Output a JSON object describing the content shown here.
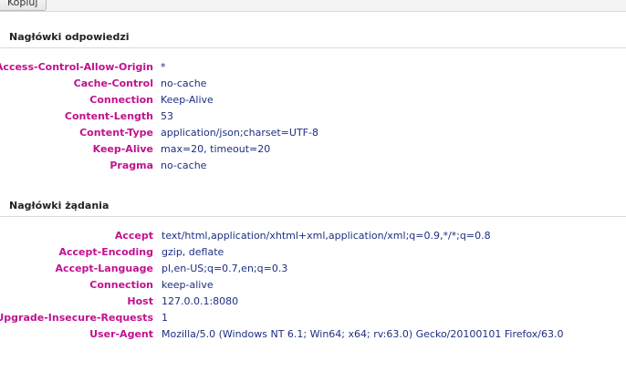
{
  "toolbar": {
    "copy_label": "Kopiuj"
  },
  "response_headers": {
    "title": "Nagłówki odpowiedzi",
    "rows": [
      {
        "name": "Access-Control-Allow-Origin",
        "value": "*"
      },
      {
        "name": "Cache-Control",
        "value": "no-cache"
      },
      {
        "name": "Connection",
        "value": "Keep-Alive"
      },
      {
        "name": "Content-Length",
        "value": "53"
      },
      {
        "name": "Content-Type",
        "value": "application/json;charset=UTF-8"
      },
      {
        "name": "Keep-Alive",
        "value": "max=20, timeout=20"
      },
      {
        "name": "Pragma",
        "value": "no-cache"
      }
    ]
  },
  "request_headers": {
    "title": "Nagłówki żądania",
    "rows": [
      {
        "name": "Accept",
        "value": "text/html,application/xhtml+xml,application/xml;q=0.9,*/*;q=0.8"
      },
      {
        "name": "Accept-Encoding",
        "value": "gzip, deflate"
      },
      {
        "name": "Accept-Language",
        "value": "pl,en-US;q=0.7,en;q=0.3"
      },
      {
        "name": "Connection",
        "value": "keep-alive"
      },
      {
        "name": "Host",
        "value": "127.0.0.1:8080"
      },
      {
        "name": "Upgrade-Insecure-Requests",
        "value": "1"
      },
      {
        "name": "User-Agent",
        "value": "Mozilla/5.0 (Windows NT 6.1; Win64; x64; rv:63.0) Gecko/20100101 Firefox/63.0"
      }
    ]
  },
  "colors": {
    "header_name": "#c0118f",
    "header_value": "#1d2f80"
  }
}
